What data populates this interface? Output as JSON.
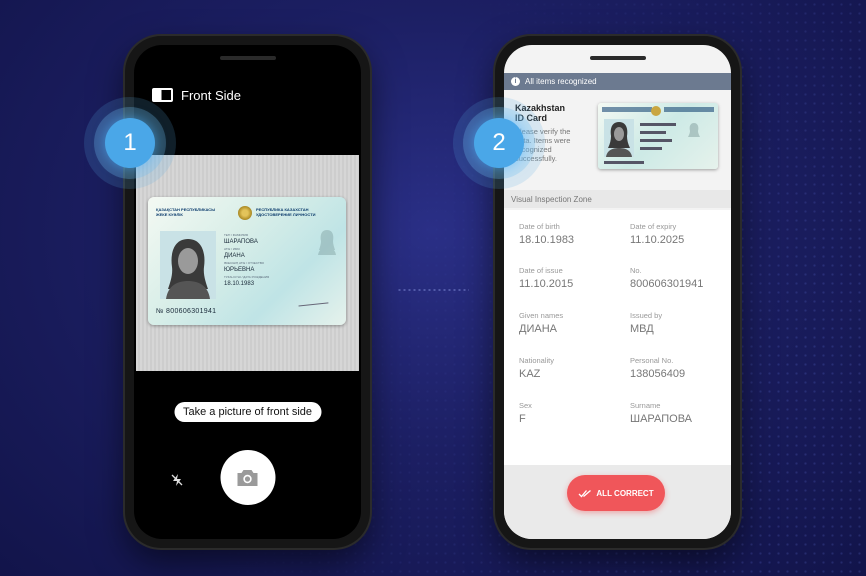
{
  "phone1": {
    "title": "Front Side",
    "prompt": "Take a picture of front side",
    "step": "1",
    "card": {
      "header_left": "ҚАЗАҚСТАН РЕСПУБЛИКАСЫ\nЖЕКЕ КУӘЛІК",
      "header_right": "РЕСПУБЛИКА КАЗАХСТАН\nУДОСТОВЕРЕНИЕ ЛИЧНОСТИ",
      "surname": "ШАРАПОВА",
      "given_name": "ДИАНА",
      "patronymic": "ЮРЬЕВНА",
      "dob": "18.10.1983",
      "number": "№ 800606301941"
    }
  },
  "phone2": {
    "banner": "All items recognized",
    "doc_title": "Kazakhstan ID Card",
    "doc_desc": "Please verify the data. Items were recognized successfully.",
    "step": "2",
    "section": "Visual Inspection Zone",
    "fields": [
      {
        "label": "Date of birth",
        "value": "18.10.1983"
      },
      {
        "label": "Date of expiry",
        "value": "11.10.2025"
      },
      {
        "label": "Date of issue",
        "value": "11.10.2015"
      },
      {
        "label": "No.",
        "value": "800606301941"
      },
      {
        "label": "Given names",
        "value": "ДИАНА"
      },
      {
        "label": "Issued by",
        "value": "МВД"
      },
      {
        "label": "Nationality",
        "value": "KAZ"
      },
      {
        "label": "Personal No.",
        "value": "138056409"
      },
      {
        "label": "Sex",
        "value": "F"
      },
      {
        "label": "Surname",
        "value": "ШАРАПОВА"
      }
    ],
    "button": "ALL CORRECT"
  },
  "colors": {
    "accent_blue": "#4aa7e8",
    "button_red": "#f0565a",
    "banner": "#6c7a90"
  }
}
